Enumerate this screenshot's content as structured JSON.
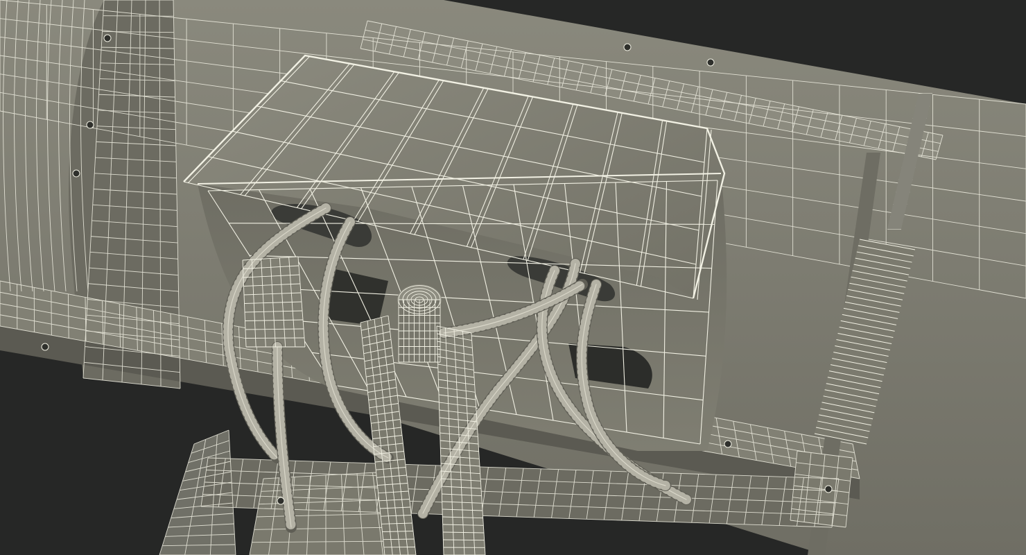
{
  "scene": {
    "subject": "wireframe-render",
    "colors": {
      "background": "#262726",
      "surface": "#7d7c70",
      "surface_dark": "#5f5e55",
      "surface_light": "#8f8e82",
      "shadow": "#3b3c38",
      "wire": "#f2f1e4",
      "wire_dim": "#d8d6c8"
    }
  }
}
